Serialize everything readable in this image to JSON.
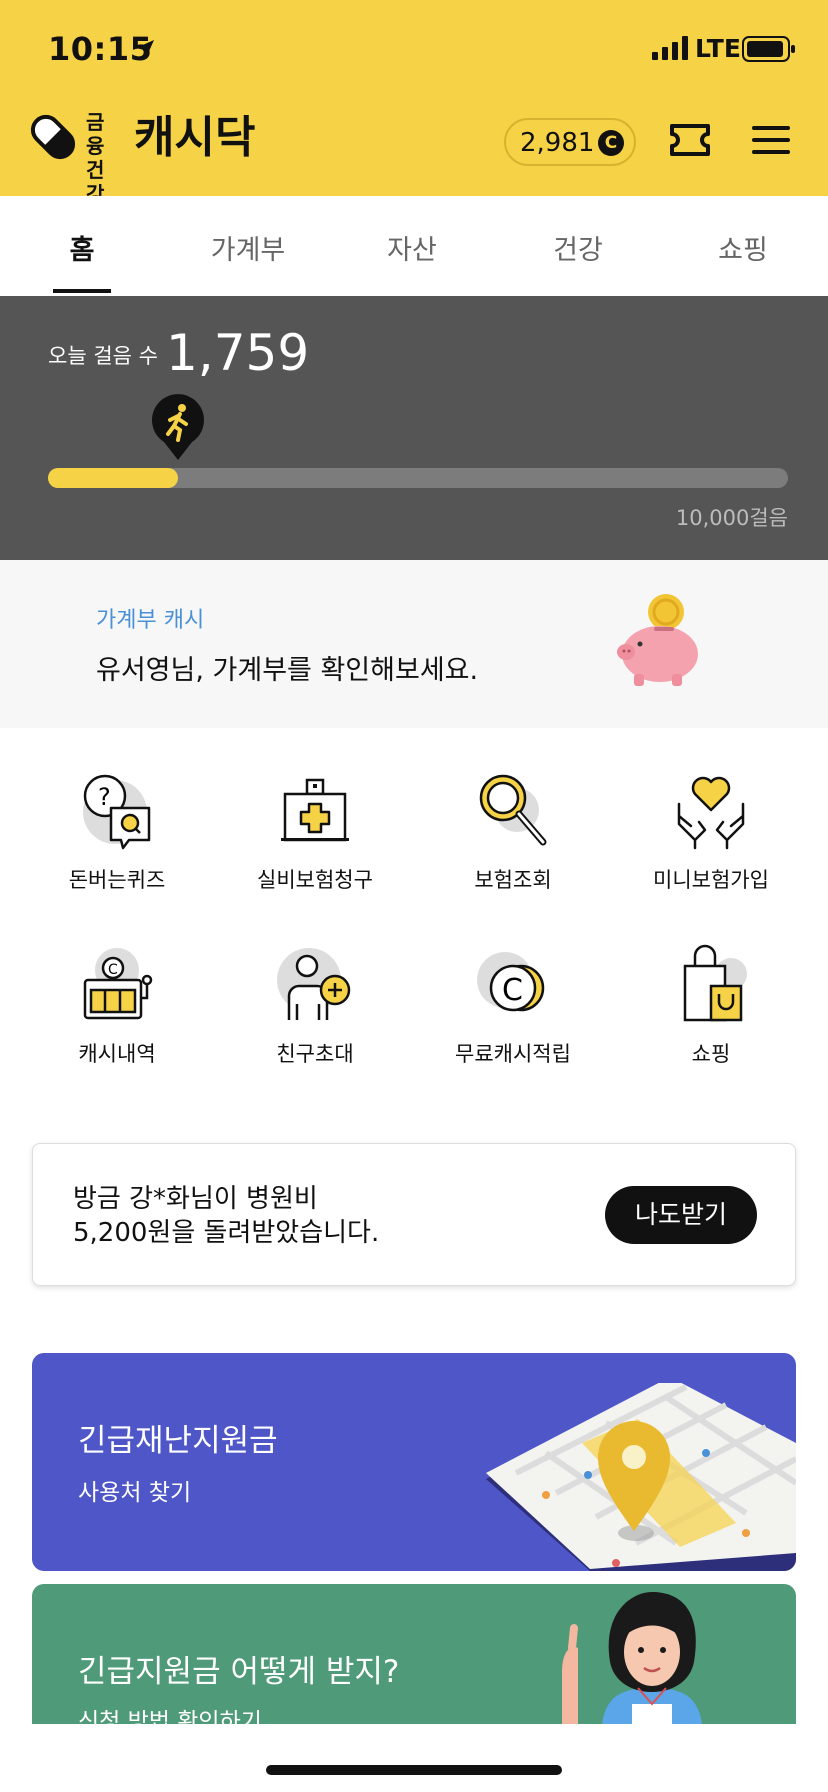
{
  "status_bar": {
    "time": "10:15",
    "network": "LTE"
  },
  "header": {
    "brand_small_line1": "금융",
    "brand_small_line2": "건강",
    "brand_name": "캐시닥",
    "cash_balance": "2,981",
    "cash_coin_symbol": "C",
    "icons": [
      "pill-logo-icon",
      "ticket-icon",
      "hamburger-menu-icon"
    ]
  },
  "tabs": [
    {
      "label": "홈",
      "active": true
    },
    {
      "label": "가계부",
      "active": false
    },
    {
      "label": "자산",
      "active": false
    },
    {
      "label": "건강",
      "active": false
    },
    {
      "label": "쇼핑",
      "active": false
    }
  ],
  "steps": {
    "label": "오늘 걸음 수",
    "count": "1,759",
    "goal_label": "10,000걸음",
    "progress_fraction": 0.1759
  },
  "household_banner": {
    "subtitle": "가계부 캐시",
    "title": "유서영님, 가계부를 확인해보세요."
  },
  "menu_grid": [
    {
      "label": "돈버는퀴즈",
      "icon": "quiz-icon"
    },
    {
      "label": "실비보험청구",
      "icon": "medical-kit-icon"
    },
    {
      "label": "보험조회",
      "icon": "magnifier-icon"
    },
    {
      "label": "미니보험가입",
      "icon": "heart-hands-icon"
    },
    {
      "label": "캐시내역",
      "icon": "slot-machine-icon"
    },
    {
      "label": "친구초대",
      "icon": "invite-friend-icon"
    },
    {
      "label": "무료캐시적립",
      "icon": "coin-stack-icon"
    },
    {
      "label": "쇼핑",
      "icon": "shopping-bag-icon"
    }
  ],
  "notice": {
    "line1": "방금 강*화님이 병원비",
    "line2": "5,200원을 돌려받았습니다.",
    "button": "나도받기"
  },
  "promos": [
    {
      "title": "긴급재난지원금",
      "subtitle": "사용처 찾기",
      "color": "#4e56c8"
    },
    {
      "title": "긴급지원금 어떻게 받지?",
      "subtitle": "신청 방법 확인하기",
      "color": "#4f9a78"
    }
  ],
  "colors": {
    "brand_yellow": "#f6d246",
    "steps_bg": "#555555",
    "link_blue": "#4a90d9"
  }
}
